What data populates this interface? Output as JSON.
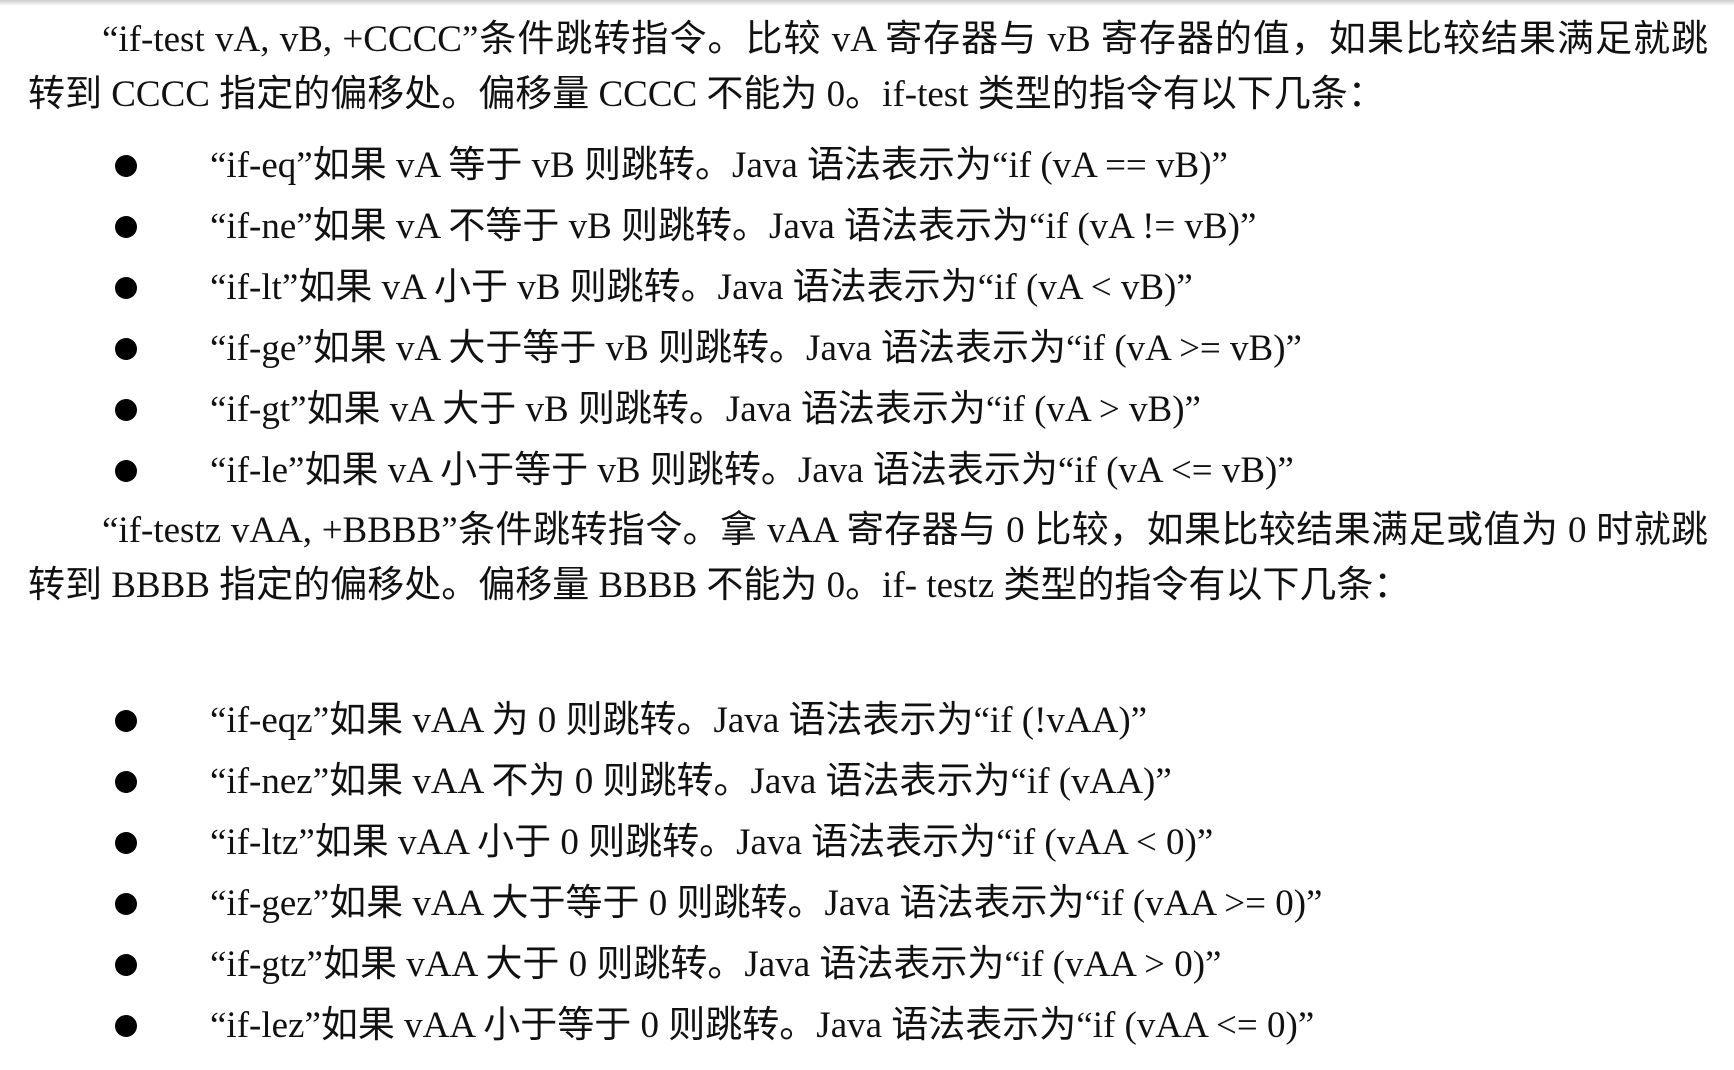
{
  "document": {
    "paragraph_1": "“if-test vA, vB, +CCCC”条件跳转指令。比较 vA 寄存器与 vB 寄存器的值，如果比较结果满足就跳转到 CCCC 指定的偏移处。偏移量 CCCC 不能为 0。if-test 类型的指令有以下几条：",
    "list_1": [
      "“if-eq”如果 vA 等于 vB 则跳转。Java 语法表示为“if (vA == vB)”",
      "“if-ne”如果 vA 不等于 vB 则跳转。Java 语法表示为“if (vA != vB)”",
      "“if-lt”如果 vA 小于 vB 则跳转。Java 语法表示为“if (vA < vB)”",
      "“if-ge”如果 vA 大于等于 vB 则跳转。Java 语法表示为“if (vA >= vB)”",
      "“if-gt”如果 vA 大于 vB 则跳转。Java 语法表示为“if (vA > vB)”",
      "“if-le”如果 vA 小于等于 vB 则跳转。Java 语法表示为“if (vA <= vB)”"
    ],
    "paragraph_2": "“if-testz vAA, +BBBB”条件跳转指令。拿 vAA 寄存器与 0 比较，如果比较结果满足或值为 0 时就跳转到 BBBB 指定的偏移处。偏移量 BBBB 不能为 0。if- testz 类型的指令有以下几条：",
    "list_2": [
      "“if-eqz”如果 vAA 为 0 则跳转。Java 语法表示为“if (!vAA)”",
      "“if-nez”如果 vAA 不为 0 则跳转。Java 语法表示为“if (vAA)”",
      "“if-ltz”如果 vAA 小于 0 则跳转。Java 语法表示为“if (vAA < 0)”",
      "“if-gez”如果 vAA 大于等于 0 则跳转。Java 语法表示为“if (vAA >= 0)”",
      "“if-gtz”如果 vAA 大于 0 则跳转。Java 语法表示为“if (vAA > 0)”",
      "“if-lez”如果 vAA 小于等于 0 则跳转。Java 语法表示为“if (vAA <= 0)”"
    ]
  }
}
